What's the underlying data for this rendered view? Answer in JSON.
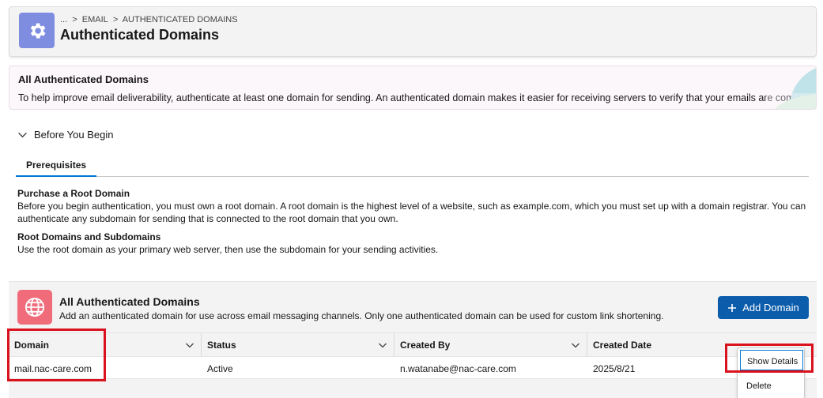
{
  "header": {
    "breadcrumb": [
      "...",
      ">",
      "EMAIL",
      ">",
      "AUTHENTICATED DOMAINS"
    ],
    "title": "Authenticated Domains"
  },
  "banner": {
    "title": "All Authenticated Domains",
    "text": "To help improve email deliverability, authenticate at least one domain for sending. An authenticated domain makes it easier for receiving servers to verify that your emails are coming from you"
  },
  "before_you_begin": {
    "label": "Before You Begin",
    "tab": "Prerequisites",
    "sections": [
      {
        "title": "Purchase a Root Domain",
        "text": "Before you begin authentication, you must own a root domain. A root domain is the highest level of a website, such as example.com, which you must set up with a domain registrar. You can authenticate any subdomain for sending that is connected to the root domain that you own."
      },
      {
        "title": "Root Domains and Subdomains",
        "text": "Use the root domain as your primary web server, then use the subdomain for your sending activities."
      }
    ]
  },
  "card": {
    "title": "All Authenticated Domains",
    "subtitle": "Add an authenticated domain for use across email messaging channels. Only one authenticated domain can be used for custom link shortening.",
    "add_button": "Add Domain"
  },
  "table": {
    "columns": [
      "Domain",
      "Status",
      "Created By",
      "Created Date"
    ],
    "rows": [
      [
        "mail.nac-care.com",
        "Active",
        "n.watanabe@nac-care.com",
        "2025/8/21"
      ]
    ]
  },
  "row_menu": {
    "items": [
      "Show Details",
      "Delete"
    ]
  },
  "colors": {
    "header_icon": "#7f8de1",
    "card_icon": "#f06c7b",
    "brand_button": "#0b5cab",
    "highlight": "#d9121e"
  }
}
